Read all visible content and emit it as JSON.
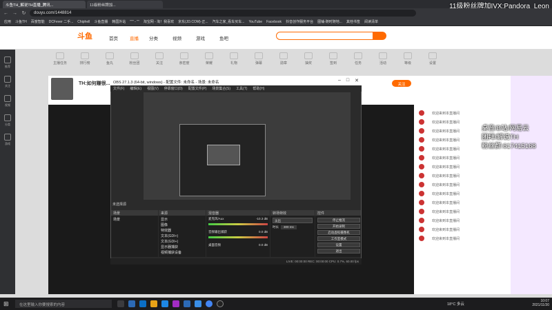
{
  "browser": {
    "tabs": [
      "斗鱼TH_解说TH直播_腾讯...",
      "11级粉丝牌加..."
    ],
    "url": "douyu.com/1448814",
    "bookmarks": [
      "应用",
      "斗鱼TH",
      "百度智能",
      "DCFever 二手...",
      "Chiphell",
      "斗鱼直播",
      "韩国外站",
      "\"\"\" - \"\"",
      "淘宝网 - 淘！我喜欢",
      "京东(JD.COM)-正...",
      "汽车之家_看车买车...",
      "YouTube",
      "Facebook",
      "抖音创作服务平台",
      "图铺-随时随地...",
      "其他书签",
      "阅读清单"
    ]
  },
  "overlay": {
    "top_right": "11级粉丝牌加IVX:Pandora_Leon",
    "right_lines": [
      "桌音/B站/网易云",
      "团拜/解说TH",
      "粉丝群:617415168"
    ]
  },
  "site": {
    "logo": "斗鱼",
    "nav": [
      "首页",
      "直播",
      "分类",
      "视频",
      "游戏",
      "鱼吧"
    ],
    "top_icons": [
      "主播任务",
      "排行榜",
      "鱼丸",
      "粉丝团",
      "关注",
      "亲密度",
      "荣耀",
      "礼物",
      "弹幕",
      "勋章",
      "抽奖",
      "签到",
      "任务",
      "活动",
      "等级",
      "设置"
    ],
    "streamer_title": "TH:如何赚很...",
    "follow_label": "关注",
    "sidebar": [
      "推荐",
      "关注",
      "视频",
      "分类",
      "游戏"
    ]
  },
  "obs": {
    "title": "OBS 27.1.3 (64-bit, windows) - 配置文件: 未命名 - 场景: 未命名",
    "menu": [
      "文件(F)",
      "编辑(E)",
      "视图(V)",
      "停靠窗口(D)",
      "配置文件(P)",
      "场景集合(S)",
      "工具(T)",
      "帮助(H)"
    ],
    "no_source": "未选择源",
    "docks": [
      "场景",
      "来源",
      "混音器",
      "转场特效",
      "控件"
    ],
    "scene_item": "场景",
    "sources": [
      "显示",
      "图像",
      "特效器",
      "文本(GDI+)",
      "文本(GDI+)",
      "显示器捕获",
      "视频捕获设备"
    ],
    "mixer": [
      "麦克风/Aux",
      "-10.3 dB",
      "音频输出捕获",
      "0.0 dB",
      "桌面音频",
      "0.0 dB"
    ],
    "transition": {
      "name": "淡出",
      "duration_label": "时长",
      "duration": "300 ms"
    },
    "controls": [
      "停止推流",
      "开始录制",
      "启动虚拟摄像机",
      "工作室模式",
      "设置",
      "退出"
    ],
    "status": "LIVE: 00:00:00   REC: 00:00:00   CPU: 0.7%, 60.00 fps"
  },
  "chat": {
    "messages": [
      "欢迎来到本直播间",
      "欢迎来到本直播间",
      "欢迎来到本直播间",
      "欢迎来到本直播间",
      "欢迎来到本直播间",
      "欢迎来到本直播间",
      "欢迎来到本直播间",
      "欢迎来到本直播间",
      "欢迎来到本直播间",
      "欢迎来到本直播间",
      "欢迎来到本直播间",
      "欢迎来到本直播间",
      "欢迎来到本直播间",
      "欢迎来到本直播间",
      "欢迎来到本直播间"
    ]
  },
  "taskbar": {
    "search_placeholder": "在这里输入你要搜索的内容",
    "weather": "18°C 多云",
    "time": "10:07",
    "date": "2021/11/30"
  },
  "colors": {
    "brand": "#ff6a00",
    "obs_bg": "#2b2b2b",
    "taskbar": "#1c1c1e"
  }
}
